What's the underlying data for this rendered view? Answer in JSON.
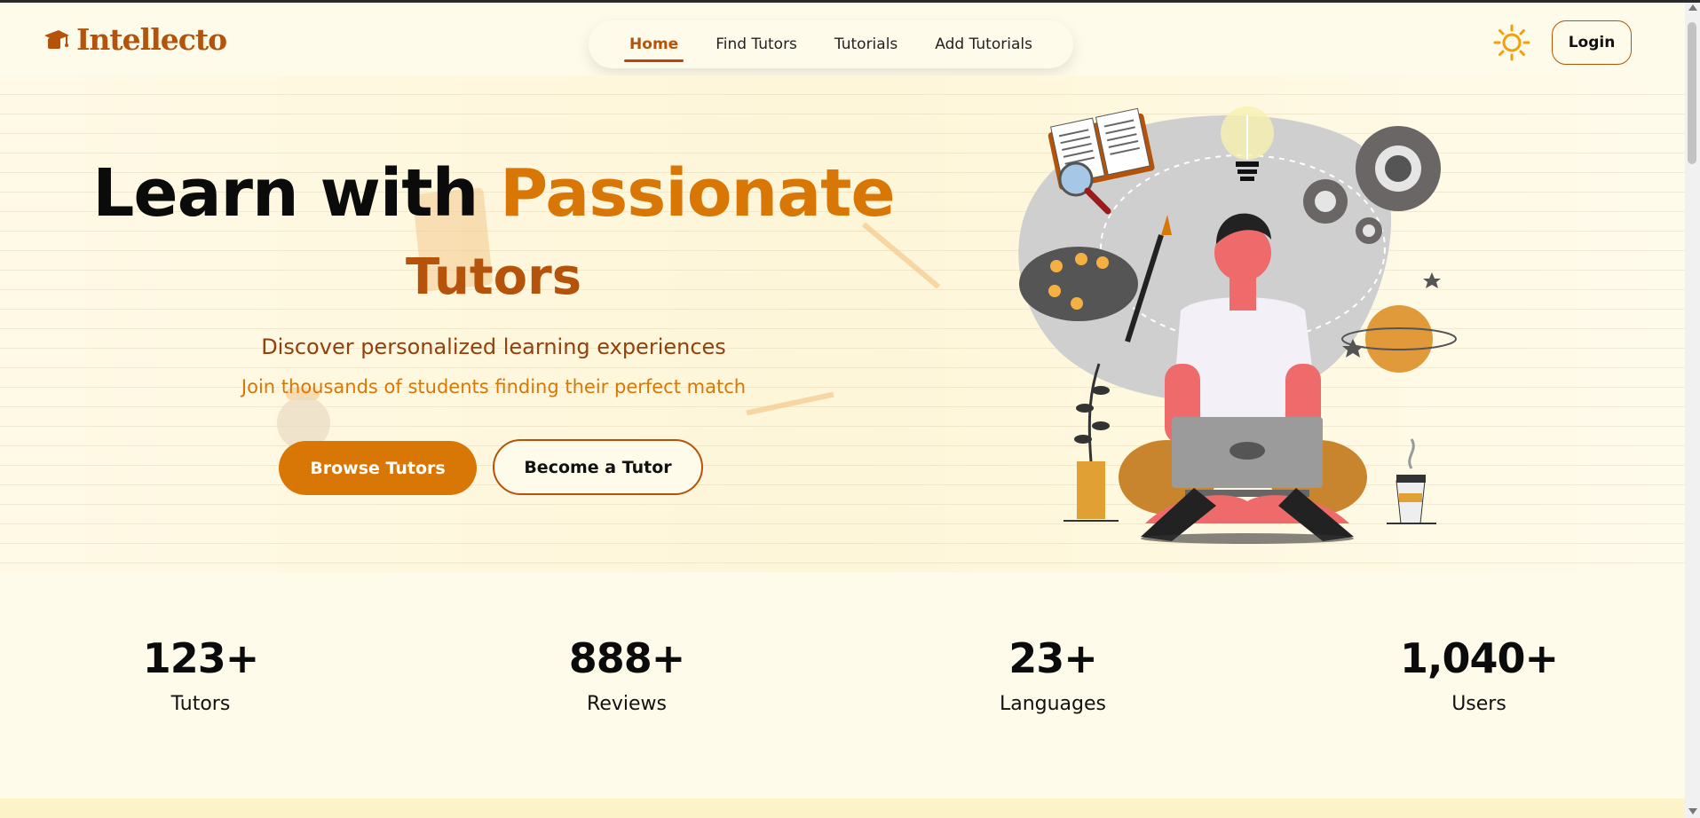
{
  "brand": {
    "name": "Intellecto",
    "color": "#b45309"
  },
  "nav": {
    "items": [
      {
        "label": "Home",
        "active": true
      },
      {
        "label": "Find Tutors",
        "active": false
      },
      {
        "label": "Tutorials",
        "active": false
      },
      {
        "label": "Add Tutorials",
        "active": false
      }
    ]
  },
  "header": {
    "theme_icon": "sun-icon",
    "login_label": "Login"
  },
  "hero": {
    "title_plain": "Learn with",
    "title_accent": "Passionate",
    "title_line2": "Tutors",
    "subtitle": "Discover personalized learning experiences",
    "subtitle2": "Join thousands of students finding their perfect match",
    "primary_button": "Browse Tutors",
    "secondary_button": "Become a Tutor",
    "illustration_icon": "student-learning-illustration"
  },
  "stats": [
    {
      "value": "123+",
      "label": "Tutors"
    },
    {
      "value": "888+",
      "label": "Reviews"
    },
    {
      "value": "23+",
      "label": "Languages"
    },
    {
      "value": "1,040+",
      "label": "Users"
    }
  ],
  "colors": {
    "accent": "#d97706",
    "accent_dark": "#b45309",
    "background": "#fffbeb"
  }
}
